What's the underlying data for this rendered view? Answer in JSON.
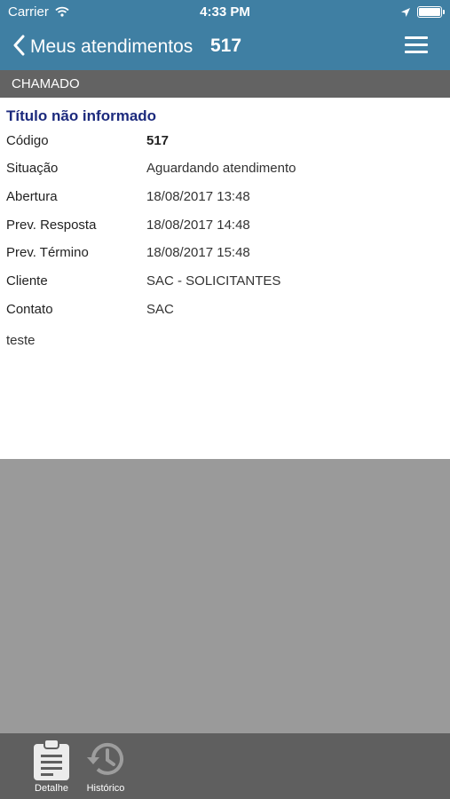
{
  "status_bar": {
    "carrier": "Carrier",
    "time": "4:33 PM"
  },
  "nav": {
    "back_label": "Meus atendimentos",
    "number": "517"
  },
  "section": {
    "title": "CHAMADO"
  },
  "ticket": {
    "title": "Título não informado",
    "fields": [
      {
        "label": "Código",
        "value": "517"
      },
      {
        "label": "Situação",
        "value": "Aguardando atendimento"
      },
      {
        "label": "Abertura",
        "value": "18/08/2017 13:48"
      },
      {
        "label": "Prev. Resposta",
        "value": "18/08/2017 14:48"
      },
      {
        "label": "Prev. Término",
        "value": "18/08/2017 15:48"
      },
      {
        "label": "Cliente",
        "value": "SAC - SOLICITANTES"
      },
      {
        "label": "Contato",
        "value": "SAC"
      }
    ],
    "description": "teste"
  },
  "tabs": [
    {
      "label": "Detalhe",
      "icon": "clipboard-icon",
      "selected": true
    },
    {
      "label": "Histórico",
      "icon": "history-icon",
      "selected": false
    }
  ]
}
